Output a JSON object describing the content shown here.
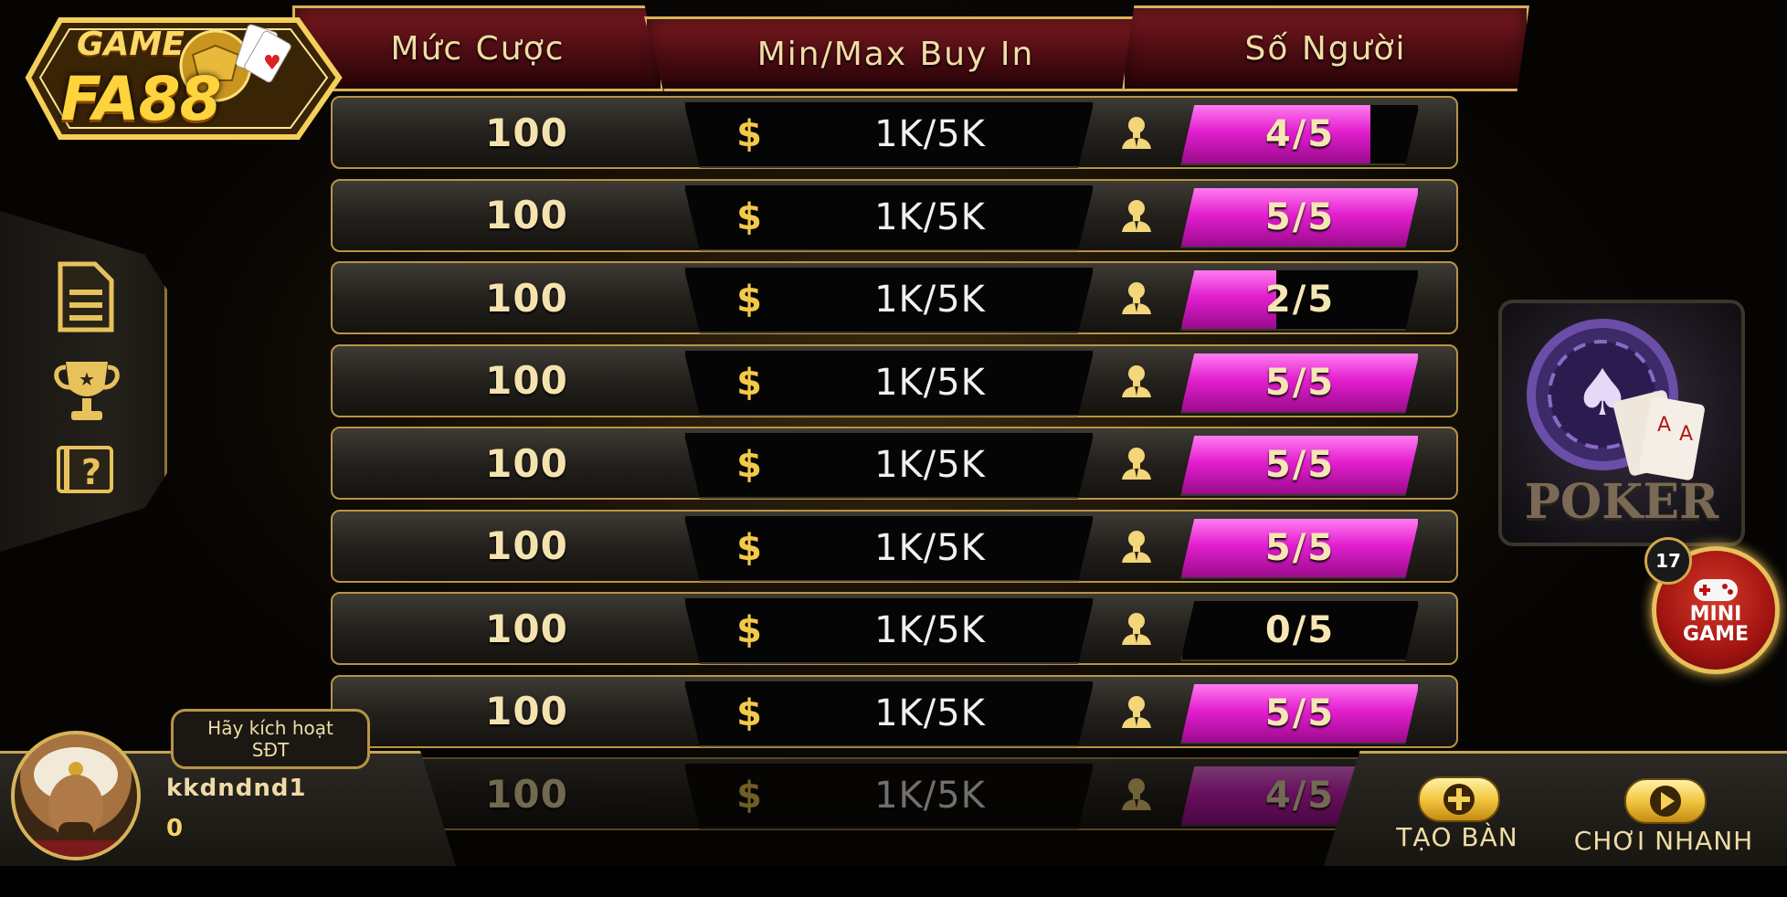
{
  "brand": {
    "game": "GAME",
    "name": "FA88"
  },
  "header": {
    "col_bet": "Mức Cược",
    "col_buyin": "Min/Max Buy In",
    "col_players": "Số Người"
  },
  "currency_symbol": "$",
  "rows": [
    {
      "bet": "100",
      "buyin": "1K/5K",
      "players": "4/5",
      "fill": 0.8
    },
    {
      "bet": "100",
      "buyin": "1K/5K",
      "players": "5/5",
      "fill": 1.0
    },
    {
      "bet": "100",
      "buyin": "1K/5K",
      "players": "2/5",
      "fill": 0.4
    },
    {
      "bet": "100",
      "buyin": "1K/5K",
      "players": "5/5",
      "fill": 1.0
    },
    {
      "bet": "100",
      "buyin": "1K/5K",
      "players": "5/5",
      "fill": 1.0
    },
    {
      "bet": "100",
      "buyin": "1K/5K",
      "players": "5/5",
      "fill": 1.0
    },
    {
      "bet": "100",
      "buyin": "1K/5K",
      "players": "0/5",
      "fill": 0.0
    },
    {
      "bet": "100",
      "buyin": "1K/5K",
      "players": "5/5",
      "fill": 1.0
    },
    {
      "bet": "100",
      "buyin": "1K/5K",
      "players": "4/5",
      "fill": 0.8
    }
  ],
  "side_menu": [
    {
      "icon": "document-icon"
    },
    {
      "icon": "trophy-icon"
    },
    {
      "icon": "help-icon"
    }
  ],
  "game_card": {
    "label": "POKER"
  },
  "mini_game": {
    "line1": "MINI",
    "line2": "GAME",
    "badge": "17"
  },
  "user": {
    "activate_line1": "Hãy kích hoạt",
    "activate_line2": "SĐT",
    "name": "kkdndnd1",
    "balance": "0"
  },
  "actions": {
    "create_table": "TẠO BÀN",
    "quick_play": "CHƠI NHANH"
  },
  "colors": {
    "gold": "#d7b25a",
    "magenta": "#e31fcf",
    "header_red": "#5a0f16"
  }
}
